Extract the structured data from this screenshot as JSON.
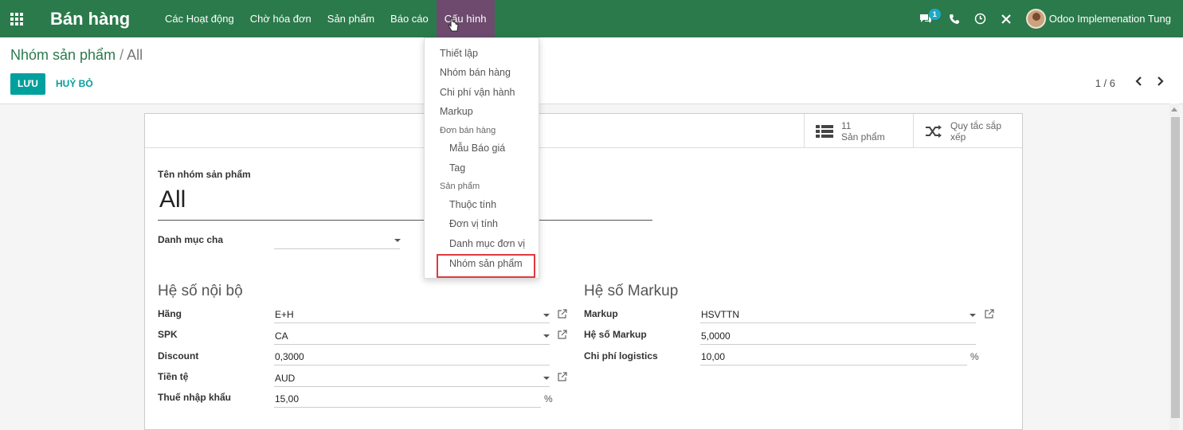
{
  "navbar": {
    "app_title": "Bán hàng",
    "menu": [
      "Các Hoạt động",
      "Chờ hóa đơn",
      "Sản phẩm",
      "Báo cáo",
      "Cấu hình"
    ],
    "chat_badge": "1",
    "user_name": "Odoo Implemenation Tung",
    "icons": [
      "apps-grid-icon",
      "chat-icon",
      "phone-icon",
      "clock-icon",
      "tools-icon"
    ]
  },
  "breadcrumb": {
    "parent": "Nhóm sản phẩm",
    "separator": "/",
    "current": "All"
  },
  "buttons": {
    "save": "LƯU",
    "discard": "HUỶ BỎ"
  },
  "pager": {
    "value": "1 / 6"
  },
  "stat_buttons": {
    "products_count": "11",
    "products_label": "Sản phẩm",
    "rules_label_1": "Quy tắc sắp",
    "rules_label_2": "xếp"
  },
  "form": {
    "name_label": "Tên nhóm sản phẩm",
    "name_value": "All",
    "parent_label": "Danh mục cha",
    "parent_value": "",
    "internal_title": "Hệ số nội bộ",
    "markup_title": "Hệ số Markup",
    "internal": [
      {
        "label": "Hãng",
        "value": "E+H"
      },
      {
        "label": "SPK",
        "value": "CA"
      },
      {
        "label": "Discount",
        "value": "0,3000"
      },
      {
        "label": "Tiền tệ",
        "value": "AUD"
      },
      {
        "label": "Thuế nhập khẩu",
        "value": "15,00",
        "suffix": "%"
      }
    ],
    "markup": [
      {
        "label": "Markup",
        "value": "HSVTTN"
      },
      {
        "label": "Hệ số Markup",
        "value": "5,0000"
      },
      {
        "label": "Chi phí logistics",
        "value": "10,00",
        "suffix": "%"
      }
    ]
  },
  "dropdown": {
    "items": [
      "Thiết lập",
      "Nhóm bán hàng",
      "Chi phí vận hành",
      "Markup"
    ],
    "header_sales": "Đơn bán hàng",
    "sales_items": [
      "Mẫu Báo giá",
      "Tag"
    ],
    "header_products": "Sản phẩm",
    "product_items": [
      "Thuộc tính",
      "Đơn vị tính",
      "Danh mục đơn vị",
      "Nhóm sản phẩm"
    ]
  },
  "colors": {
    "navbar": "#2b7a4b",
    "active_menu": "#6e4a6f",
    "primary_button": "#00a09d",
    "highlight_border": "#e0393e"
  }
}
